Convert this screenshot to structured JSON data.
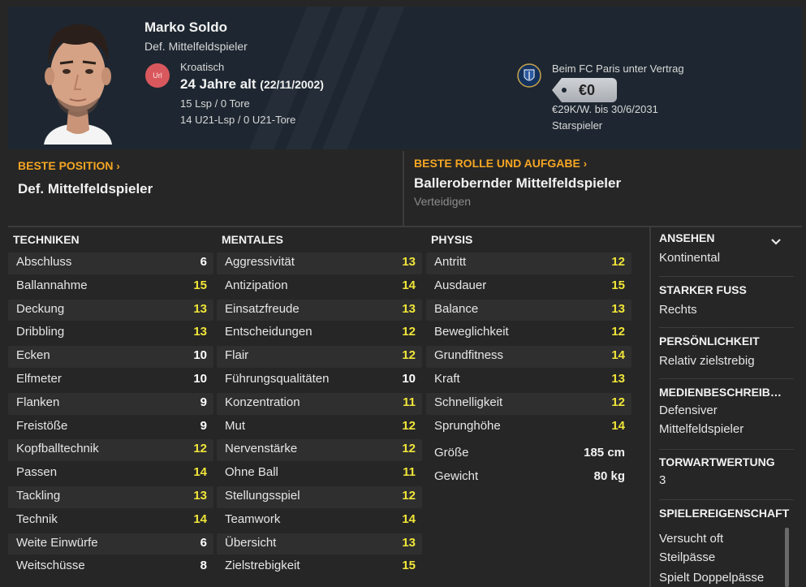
{
  "player": {
    "name": "Marko Soldo",
    "position": "Def. Mittelfeldspieler",
    "url_badge": "Url",
    "nationality": "Kroatisch",
    "age": "24 Jahre alt",
    "dob": "(22/11/2002)",
    "caps": "15 Lsp / 0 Tore",
    "u21_caps": "14 U21-Lsp / 0 U21-Tore"
  },
  "contract": {
    "title": "Beim FC Paris unter Vertrag",
    "value": "€0",
    "wage": "€29K/W. bis 30/6/2031",
    "status": "Starspieler"
  },
  "best_position": {
    "label": "BESTE POSITION",
    "chevron": "›",
    "value": "Def. Mittelfeldspieler"
  },
  "best_role": {
    "label": "BESTE ROLLE UND AUFGABE",
    "chevron": "›",
    "value": "Ballerobernder Mittelfeldspieler",
    "duty": "Verteidigen"
  },
  "technik": {
    "title": "TECHNIKEN",
    "rows": [
      {
        "name": "Abschluss",
        "value": "6"
      },
      {
        "name": "Ballannahme",
        "value": "15"
      },
      {
        "name": "Deckung",
        "value": "13"
      },
      {
        "name": "Dribbling",
        "value": "13"
      },
      {
        "name": "Ecken",
        "value": "10"
      },
      {
        "name": "Elfmeter",
        "value": "10"
      },
      {
        "name": "Flanken",
        "value": "9"
      },
      {
        "name": "Freistöße",
        "value": "9"
      },
      {
        "name": "Kopfballtechnik",
        "value": "12"
      },
      {
        "name": "Passen",
        "value": "14"
      },
      {
        "name": "Tackling",
        "value": "13"
      },
      {
        "name": "Technik",
        "value": "14"
      },
      {
        "name": "Weite Einwürfe",
        "value": "6"
      },
      {
        "name": "Weitschüsse",
        "value": "8"
      }
    ]
  },
  "mental": {
    "title": "MENTALES",
    "rows": [
      {
        "name": "Aggressivität",
        "value": "13"
      },
      {
        "name": "Antizipation",
        "value": "14"
      },
      {
        "name": "Einsatzfreude",
        "value": "13"
      },
      {
        "name": "Entscheidungen",
        "value": "12"
      },
      {
        "name": "Flair",
        "value": "12"
      },
      {
        "name": "Führungsqualitäten",
        "value": "10"
      },
      {
        "name": "Konzentration",
        "value": "11"
      },
      {
        "name": "Mut",
        "value": "12"
      },
      {
        "name": "Nervenstärke",
        "value": "12"
      },
      {
        "name": "Ohne Ball",
        "value": "11"
      },
      {
        "name": "Stellungsspiel",
        "value": "12"
      },
      {
        "name": "Teamwork",
        "value": "14"
      },
      {
        "name": "Übersicht",
        "value": "13"
      },
      {
        "name": "Zielstrebigkeit",
        "value": "15"
      }
    ]
  },
  "physis": {
    "title": "PHYSIS",
    "rows": [
      {
        "name": "Antritt",
        "value": "12"
      },
      {
        "name": "Ausdauer",
        "value": "15"
      },
      {
        "name": "Balance",
        "value": "13"
      },
      {
        "name": "Beweglichkeit",
        "value": "12"
      },
      {
        "name": "Grundfitness",
        "value": "14"
      },
      {
        "name": "Kraft",
        "value": "13"
      },
      {
        "name": "Schnelligkeit",
        "value": "12"
      },
      {
        "name": "Sprunghöhe",
        "value": "14"
      }
    ],
    "height_label": "Größe",
    "height_value": "185 cm",
    "weight_label": "Gewicht",
    "weight_value": "80 kg"
  },
  "sidebar": {
    "reputation_title": "ANSEHEN",
    "reputation_value": "Kontinental",
    "foot_title": "STARKER FUSS",
    "foot_value": "Rechts",
    "personality_title": "PERSÖNLICHKEIT",
    "personality_value": "Relativ zielstrebig",
    "media_title": "MEDIENBESCHREIB…",
    "media_value": "Defensiver Mittelfeldspieler",
    "gk_title": "TORWARTWERTUNG",
    "gk_value": "3",
    "traits_title": "SPIELEREIGENSCHAFT",
    "traits": [
      "Versucht oft Steilpässe",
      "Spielt Doppelpässe"
    ]
  },
  "colors": {
    "accent_orange": "#f5a623",
    "attr_yellow": "#f1e639",
    "header_bg": "#1e2731",
    "page_bg": "#262626"
  },
  "icons": {
    "club_badge": "fc-paris-crest-icon",
    "dropdown": "chevron-down-icon"
  }
}
